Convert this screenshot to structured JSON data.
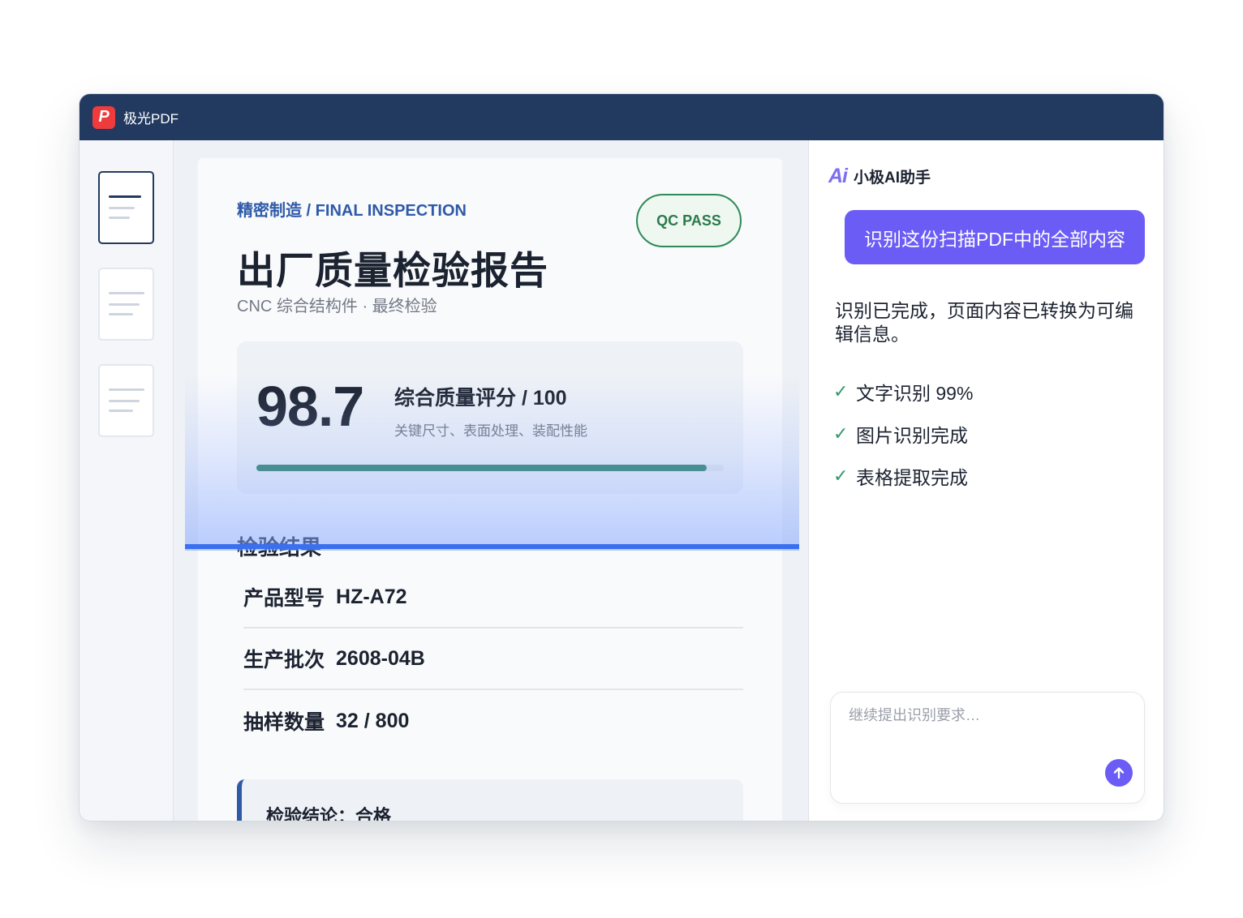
{
  "app": {
    "title": "极光PDF",
    "logo_letter": "P"
  },
  "thumbnails": [
    {
      "active": true
    },
    {
      "active": false
    },
    {
      "active": false
    }
  ],
  "document": {
    "crumb": "精密制造 / FINAL INSPECTION",
    "badge": "QC PASS",
    "title": "出厂质量检验报告",
    "subtitle": "CNC 综合结构件 · 最终检验",
    "score": {
      "value": "98.7",
      "label": "综合质量评分 / 100",
      "desc": "关键尺寸、表面处理、装配性能",
      "progress": 0.963
    },
    "section_title": "检验结果",
    "rows": [
      {
        "key": "产品型号",
        "value": "HZ-A72"
      },
      {
        "key": "生产批次",
        "value": "2608-04B"
      },
      {
        "key": "抽样数量",
        "value": "32 / 800"
      }
    ],
    "conclusion": "检验结论：合格"
  },
  "assistant": {
    "icon": "Ai",
    "name": "小极AI助手",
    "user_message": "识别这份扫描PDF中的全部内容",
    "reply": "识别已完成，页面内容已转换为可编辑信息。",
    "checks": [
      "文字识别 99%",
      "图片识别完成",
      "表格提取完成"
    ],
    "check_mark": "✓",
    "input_placeholder": "继续提出识别要求…",
    "send_icon": "arrow-up-icon"
  },
  "colors": {
    "titlebar": "#233a60",
    "accent": "#6b5cf6",
    "pass": "#2f8a56",
    "scan": "#3a6ff0"
  }
}
